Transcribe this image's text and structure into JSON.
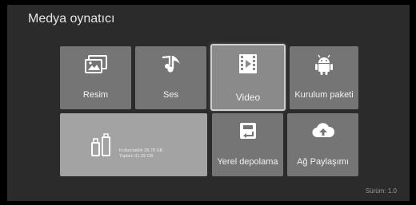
{
  "app": {
    "title": "Medya oynatıcı",
    "version": "Sürüm: 1.0"
  },
  "tiles": {
    "image": {
      "label": "Resim",
      "icon": "image-icon"
    },
    "audio": {
      "label": "Ses",
      "icon": "music-note-icon"
    },
    "video": {
      "label": "Video",
      "icon": "film-icon",
      "selected": true
    },
    "install": {
      "label": "Kurulum paketi",
      "icon": "android-icon"
    },
    "usb": {
      "icon": "usb-drive-icon",
      "available": "Kullanılabilir 28,78 GB",
      "total": "Toplam 31,39 GB"
    },
    "local": {
      "label": "Yerel depolama",
      "icon": "storage-icon"
    },
    "network": {
      "label": "Ağ Paylaşımı",
      "icon": "cloud-upload-icon"
    }
  },
  "colors": {
    "background": "#2b2b2b",
    "tile": "#757575",
    "tile_selected": "#8a8a8a",
    "tile_usb": "#a3a3a3",
    "text": "#ffffff"
  }
}
